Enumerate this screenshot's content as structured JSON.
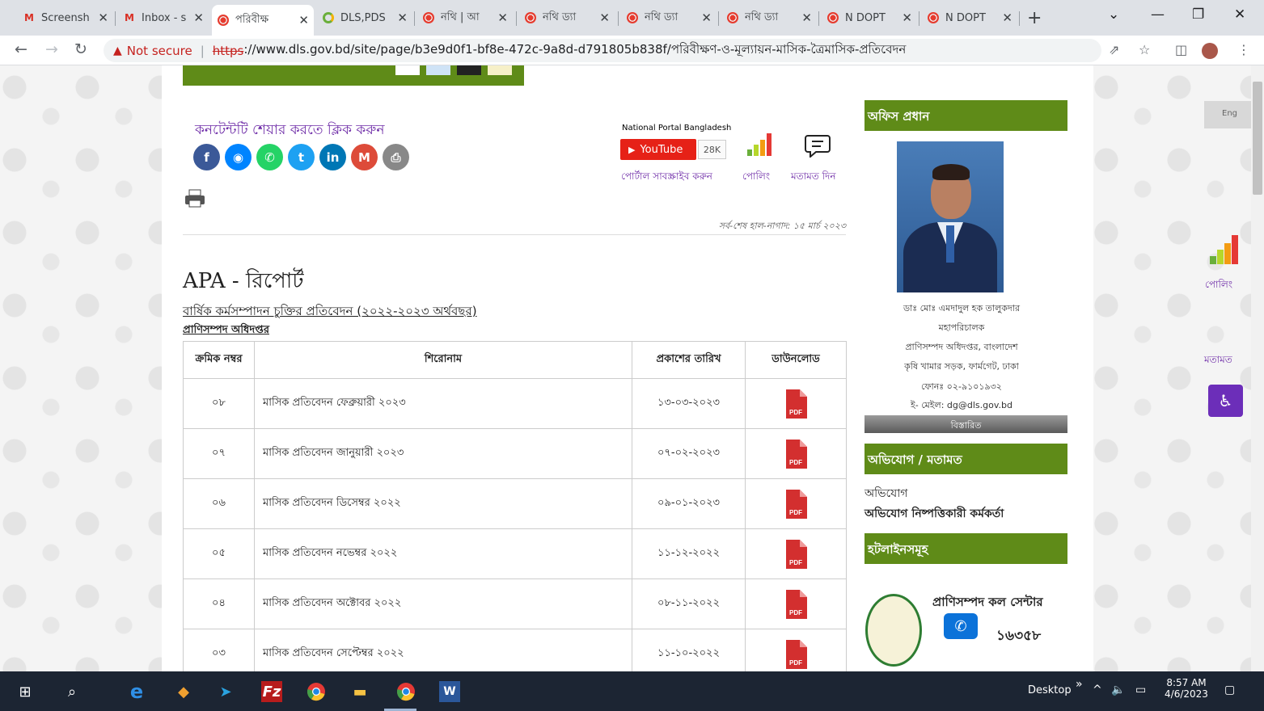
{
  "browser": {
    "tabs": [
      {
        "title": "Screensh",
        "icon": "gmail"
      },
      {
        "title": "Inbox - s",
        "icon": "gmail"
      },
      {
        "title": "পরিবীক্ষ",
        "icon": "bd-portal",
        "active": true
      },
      {
        "title": "DLS,PDS",
        "icon": "dls"
      },
      {
        "title": "নথি | আ",
        "icon": "bd-portal"
      },
      {
        "title": "নথি ড্যা",
        "icon": "bd-portal"
      },
      {
        "title": "নথি ড্যা",
        "icon": "bd-portal"
      },
      {
        "title": "নথি ড্যা",
        "icon": "bd-portal"
      },
      {
        "title": "N DOPT",
        "icon": "bd-portal"
      },
      {
        "title": "N DOPT",
        "icon": "bd-portal"
      }
    ],
    "not_secure": "Not secure",
    "url_scheme": "https",
    "url_rest": "://www.dls.gov.bd/site/page/b3e9d0f1-bf8e-472c-9a8d-d791805b838f/পরিবীক্ষণ-ও-মূল্যায়ন-মাসিক-ত্রৈমাসিক-প্রতিবেদন"
  },
  "share": {
    "title": "কনটেন্টটি শেয়ার করতে ক্লিক করুন",
    "icons": [
      {
        "name": "facebook-icon",
        "glyph": "f",
        "color": "#3b5998"
      },
      {
        "name": "messenger-icon",
        "glyph": "◉",
        "color": "#0084ff"
      },
      {
        "name": "whatsapp-icon",
        "glyph": "✆",
        "color": "#25d366"
      },
      {
        "name": "twitter-icon",
        "glyph": "t",
        "color": "#1da1f2"
      },
      {
        "name": "linkedin-icon",
        "glyph": "in",
        "color": "#0077b5"
      },
      {
        "name": "gmail-icon",
        "glyph": "M",
        "color": "#dd4b39"
      },
      {
        "name": "print-share-icon",
        "glyph": "⎙",
        "color": "#888888"
      }
    ]
  },
  "portal": {
    "label": "National Portal Bangladesh",
    "youtube": "YouTube",
    "count": "28K",
    "subscribe": "পোর্টাল সাবস্ক্রাইব করুন",
    "poll": "পোলিং",
    "opinion": "মতামত দিন"
  },
  "updated": "সর্ব-শেষ হাল-নাগাদ: ১৫ মার্চ ২০২৩",
  "page_title": "APA - রিপোর্ট",
  "report_link": "বার্ষিক কর্মসম্পাদন চুক্তির প্রতিবেদন  (২০২২-২০২৩ অর্থবছর)",
  "dept_link": "প্রাণিসম্পদ অধিদপ্তর",
  "table": {
    "headers": [
      "ক্রমিক নম্বর",
      "শিরোনাম",
      "প্রকাশের তারিখ",
      "ডাউনলোড"
    ],
    "rows": [
      {
        "num": "০৮",
        "title": "মাসিক প্রতিবেদন ফেব্রুয়ারী ২০২৩",
        "date": "১৩-০৩-২০২৩"
      },
      {
        "num": "০৭",
        "title": "মাসিক প্রতিবেদন জানুয়ারী ২০২৩",
        "date": "০৭-০২-২০২৩"
      },
      {
        "num": "০৬",
        "title": "মাসিক প্রতিবেদন ডিসেম্বর ২০২২",
        "date": "০৯-০১-২০২৩"
      },
      {
        "num": "০৫",
        "title": "মাসিক প্রতিবেদন নভেম্বর ২০২২",
        "date": "১১-১২-২০২২"
      },
      {
        "num": "০৪",
        "title": "মাসিক প্রতিবেদন অক্টোবর ২০২২",
        "date": "০৮-১১-২০২২"
      },
      {
        "num": "০৩",
        "title": "মাসিক প্রতিবেদন সেপ্টেম্বর ২০২২",
        "date": "১১-১০-২০২২"
      }
    ],
    "pdf_label": "PDF"
  },
  "sidebar": {
    "office_head": "অফিস প্রধান",
    "officer_lines": [
      "ডাঃ মোঃ এমদাদুল হক তালুকদার",
      "মহাপরিচালক",
      "প্রাণিসম্পদ অধিদপ্তর, বাংলাদেশ",
      "কৃষি খামার সড়ক, ফার্মগেট, ঢাকা",
      "ফোনঃ ০২-৯১০১৯৩২",
      "ই- মেইল: dg@dls.gov.bd"
    ],
    "details": "বিস্তারিত",
    "complaint_head": "অভিযোগ / মতামত",
    "complaint_items": [
      "অভিযোগ",
      "অভিযোগ নিষ্পত্তিকারী কর্মকর্তা"
    ],
    "hotline_head": "হটলাইনসমূহ",
    "call_label": "প্রাণিসম্পদ  কল সেন্টার",
    "call_num": "১৬৩৫৮"
  },
  "right_float": {
    "lang": "Eng",
    "poll": "পোলিং",
    "opinion": "মতামত"
  },
  "taskbar": {
    "desktop": "Desktop",
    "time": "8:57 AM",
    "date": "4/6/2023"
  }
}
